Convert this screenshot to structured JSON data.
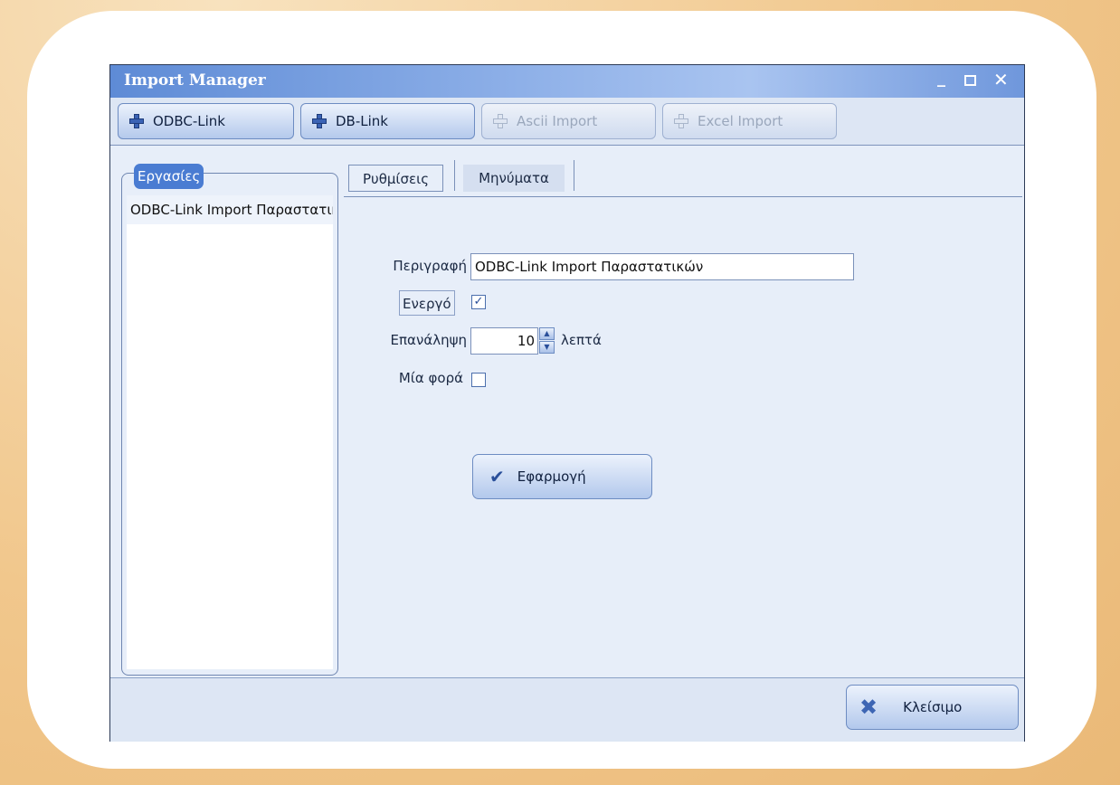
{
  "window": {
    "title": "Import Manager",
    "controls": {
      "minimize": "_",
      "maximize": "□",
      "close": "✕"
    }
  },
  "toolbar": {
    "buttons": [
      {
        "label": "ODBC-Link",
        "icon": "plus-icon",
        "enabled": true
      },
      {
        "label": "DB-Link",
        "icon": "plus-icon",
        "enabled": true
      },
      {
        "label": "Ascii Import",
        "icon": "plus-icon",
        "enabled": false
      },
      {
        "label": "Excel Import",
        "icon": "plus-icon",
        "enabled": false
      }
    ]
  },
  "tasks": {
    "title": "Εργασίες",
    "items": [
      "ODBC-Link Import Παραστατικών"
    ]
  },
  "tabs": [
    {
      "label": "Ρυθμίσεις",
      "active": true
    },
    {
      "label": "Μηνύματα",
      "active": false
    }
  ],
  "settings": {
    "description_label": "Περιγραφή",
    "description_value": "ODBC-Link Import Παραστατικών",
    "active_label": "Ενεργό",
    "active_checked": true,
    "repeat_label": "Επανάληψη",
    "repeat_value": "10",
    "repeat_unit": "λεπτά",
    "once_label": "Μία φορά",
    "once_checked": false
  },
  "apply_button": {
    "label": "Εφαρμογή",
    "icon": "check-icon"
  },
  "footer": {
    "close_label": "Κλείσιμο",
    "close_icon": "close-x-icon"
  },
  "colors": {
    "title_gradient_start": "#5e8bd6",
    "legend_bg": "#4a7cd2",
    "window_bg": "#e7eef9"
  }
}
